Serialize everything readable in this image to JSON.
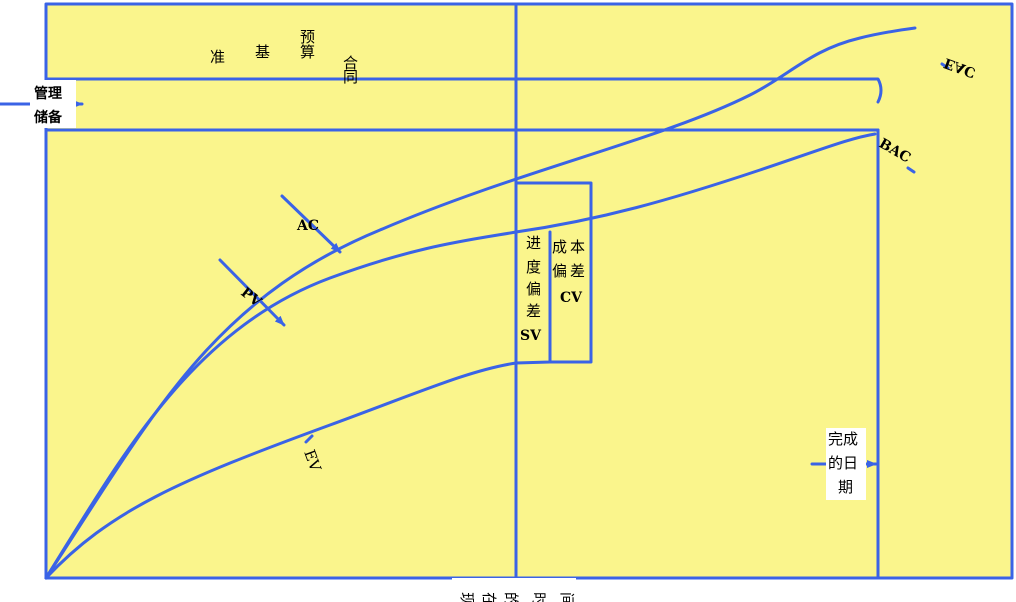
{
  "colors": {
    "background": "#FAF58C",
    "line": "#3A63E6",
    "text": "#000000",
    "label_bg": "#FFFFFF"
  },
  "labels": {
    "contract_budget_baseline": [
      "合",
      "同",
      "预",
      "算",
      "基",
      "准"
    ],
    "management_reserve": [
      "管理",
      "储备"
    ],
    "ac": "AC",
    "pv": "PV",
    "ev": "EV",
    "eac": "EAC",
    "bac": "BAC",
    "schedule_variance": [
      "进",
      "度",
      "偏",
      "差",
      "SV"
    ],
    "cost_variance": [
      "成",
      "本",
      "偏",
      "差",
      "CV"
    ],
    "completion_date": [
      "完成",
      "的日",
      "期"
    ],
    "current_time": [
      "现",
      "在",
      "的",
      "时",
      "间"
    ]
  }
}
